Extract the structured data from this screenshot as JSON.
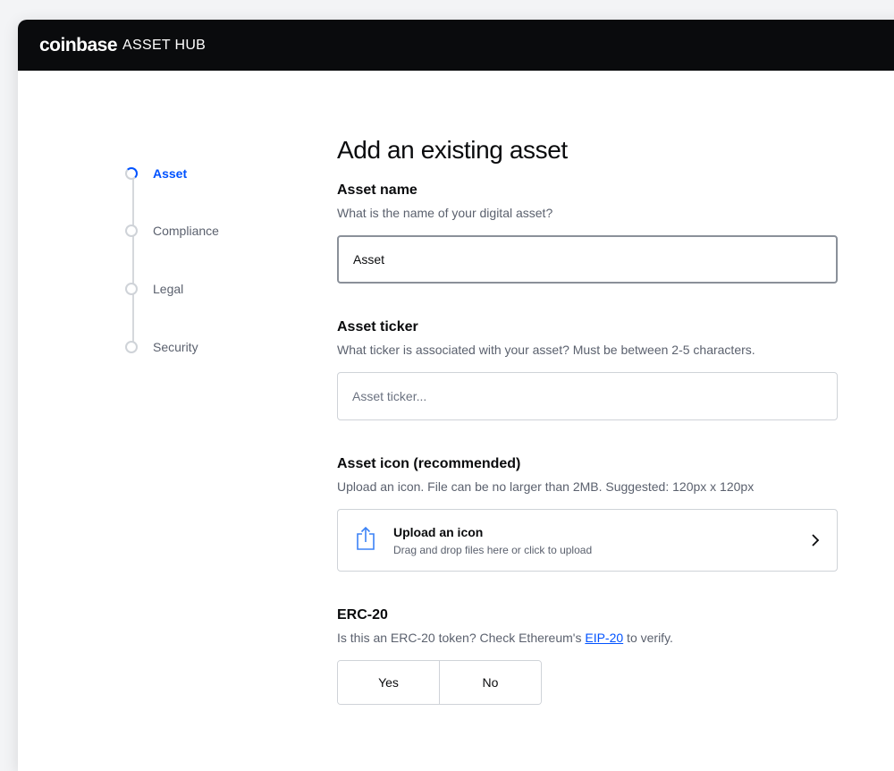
{
  "header": {
    "brand": "coinbase",
    "product": "ASSET HUB"
  },
  "stepper": {
    "steps": [
      {
        "label": "Asset",
        "active": true
      },
      {
        "label": "Compliance",
        "active": false
      },
      {
        "label": "Legal",
        "active": false
      },
      {
        "label": "Security",
        "active": false
      }
    ]
  },
  "form": {
    "title": "Add an existing asset",
    "asset_name": {
      "label": "Asset name",
      "description": "What is the name of your digital asset?",
      "value": "Asset"
    },
    "asset_ticker": {
      "label": "Asset ticker",
      "description": "What ticker is associated with your asset? Must be between 2-5 characters.",
      "placeholder": "Asset ticker..."
    },
    "asset_icon": {
      "label": "Asset icon (recommended)",
      "description": "Upload an icon. File can be no larger than 2MB. Suggested: 120px x 120px",
      "upload_title": "Upload an icon",
      "upload_subtitle": "Drag and drop files here or click to upload"
    },
    "erc20": {
      "label": "ERC-20",
      "description_prefix": "Is this an ERC-20 token? Check Ethereum's ",
      "link_text": "EIP-20",
      "description_suffix": " to verify.",
      "options": [
        "Yes",
        "No"
      ]
    }
  },
  "colors": {
    "accent": "#0052ff",
    "topbar": "#0a0b0d",
    "border": "#cfd3d8"
  },
  "icons": {
    "upload": "upload-share-icon",
    "chevron": "chevron-right-icon"
  }
}
